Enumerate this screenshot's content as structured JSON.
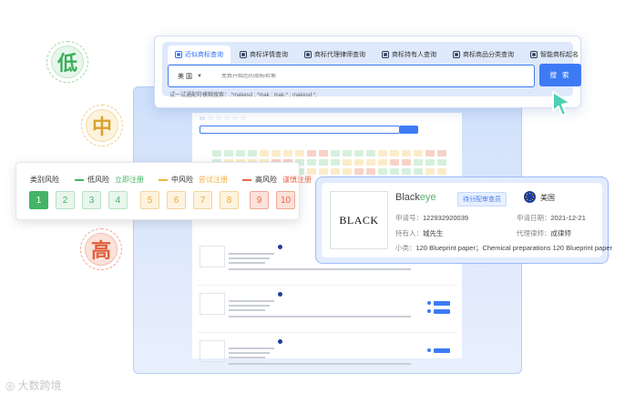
{
  "risk_circles": {
    "low": "低",
    "mid": "中",
    "high": "高"
  },
  "search_panel": {
    "tabs": [
      {
        "label": "近似商标查询",
        "active": true
      },
      {
        "label": "商标详情查询",
        "active": false
      },
      {
        "label": "商标代理律师查询",
        "active": false
      },
      {
        "label": "商标持有人查询",
        "active": false
      },
      {
        "label": "商标商品分类查询",
        "active": false
      },
      {
        "label": "智能商标起名",
        "active": false
      }
    ],
    "country": "美 国",
    "placeholder": "免费开始您的商标检索",
    "search_button": "搜 索",
    "hint": "试一试通配符模糊搜索：.*makesd ; *mak ; mak.* ; makesd.*;"
  },
  "legend": {
    "category_label": "类别风险",
    "low_label": "低风险",
    "low_note": "立即注册",
    "mid_label": "中风险",
    "mid_note": "尝试注册",
    "high_label": "高风险",
    "high_note": "谨慎注册",
    "numbers": [
      "1",
      "2",
      "3",
      "4",
      "5",
      "6",
      "7",
      "8",
      "9",
      "10"
    ],
    "colors": {
      "low": "#45b465",
      "mid": "#f0b340",
      "high": "#e8674a"
    }
  },
  "detail": {
    "logo_text": "BLACK",
    "brand_prefix": "Black",
    "brand_suffix": "eye",
    "status": "待分配审查员",
    "country": "美国",
    "reg_no_label": "申请号：",
    "reg_no": "122932920039",
    "date_label": "申请日期：",
    "date": "2021-12-21",
    "holder_label": "持有人：",
    "holder": "城先生",
    "agent_label": "代理律师：",
    "agent": "成律师",
    "class_label": "小类：",
    "class_text": "120 Blueprint paper；Chemical preparations 120 Blueprint paper"
  },
  "watermark": "大数跨境"
}
